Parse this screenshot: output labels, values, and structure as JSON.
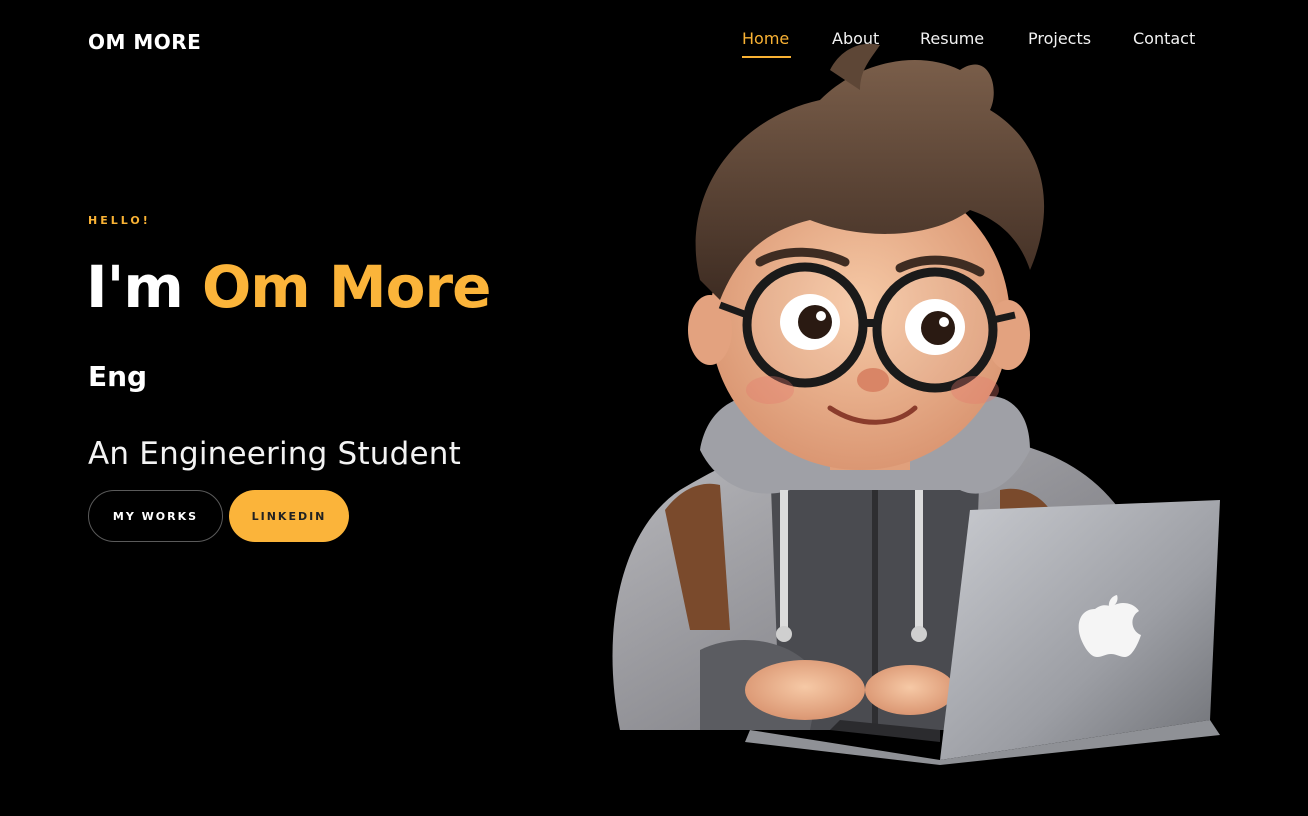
{
  "brand": {
    "logo": "OM MORE"
  },
  "nav": {
    "items": [
      {
        "label": "Home",
        "active": true
      },
      {
        "label": "About",
        "active": false
      },
      {
        "label": "Resume",
        "active": false
      },
      {
        "label": "Projects",
        "active": false
      },
      {
        "label": "Contact",
        "active": false
      }
    ]
  },
  "hero": {
    "greeting": "HELLO!",
    "headline_prefix": "I'm",
    "headline_name": "Om More",
    "subtitle": "Eng",
    "role": "An Engineering Student",
    "buttons": {
      "primary": "MY WORKS",
      "secondary": "LINKEDIN"
    }
  },
  "illustration": {
    "icon": "boy-with-laptop-avatar"
  },
  "colors": {
    "accent": "#fbb43a",
    "background": "#000000",
    "text": "#ffffff"
  }
}
